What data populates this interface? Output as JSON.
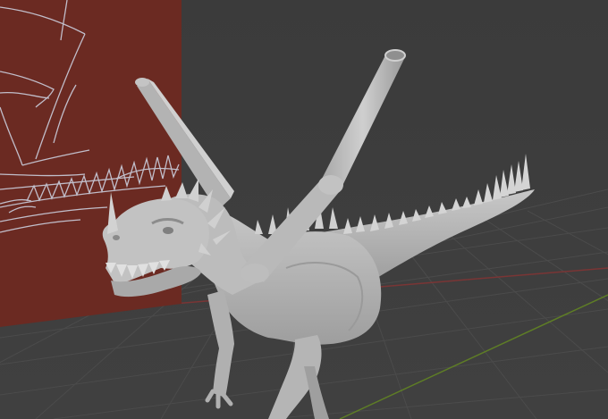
{
  "viewport": {
    "kind": "3d-viewport",
    "background_color": "#3d3d3d",
    "grid_color": "#4a4a4a",
    "axis_x_color": "#8a3a3a",
    "axis_y_color": "#6a8a2a"
  },
  "reference_image": {
    "subject": "dragon-wing-sketch",
    "fill_color": "#6b2a22",
    "line_color": "#c9c9d6"
  },
  "model": {
    "subject": "dragon",
    "material_color": "#bdbdbd",
    "shadow_color": "#8e8e8e"
  }
}
